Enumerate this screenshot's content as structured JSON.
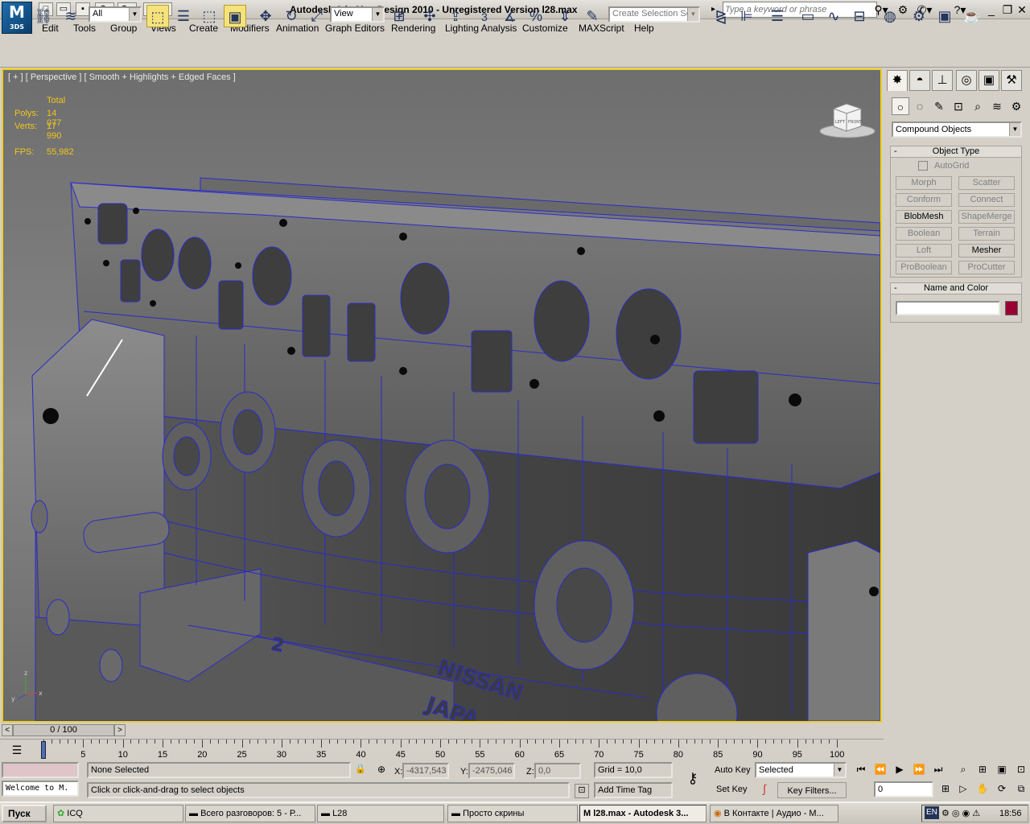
{
  "app": {
    "title": "Autodesk 3ds Max Design 2010  - Unregistered Version    l28.max",
    "logo_text": "3DS",
    "search_placeholder": "Type a keyword or phrase"
  },
  "menu": [
    "Edit",
    "Tools",
    "Group",
    "Views",
    "Create",
    "Modifiers",
    "Animation",
    "Graph Editors",
    "Rendering",
    "Lighting Analysis",
    "Customize",
    "MAXScript",
    "Help"
  ],
  "toolbar": {
    "filter_value": "All",
    "refcoord_value": "View",
    "selection_set_placeholder": "Create Selection Se",
    "snap_label": "3"
  },
  "viewport": {
    "label": "[ + ] [ Perspective ] [ Smooth + Highlights + Edged Faces ]",
    "stats": {
      "total_label": "Total",
      "polys_label": "Polys:",
      "polys_value": "14 077",
      "verts_label": "Verts:",
      "verts_value": "17 990",
      "fps_label": "FPS:",
      "fps_value": "55,982"
    },
    "viewcube": {
      "left": "LEFT",
      "front": "FRONT"
    },
    "axis": {
      "x": "x",
      "y": "y",
      "z": "z"
    },
    "engraving": {
      "number": "2",
      "brand_top": "NISSAN",
      "brand_bottom": "JAPA"
    }
  },
  "command_panel": {
    "category_value": "Compound Objects",
    "object_type": {
      "title": "Object Type",
      "autogrid": "AutoGrid",
      "buttons": [
        {
          "label": "Morph",
          "enabled": false
        },
        {
          "label": "Scatter",
          "enabled": false
        },
        {
          "label": "Conform",
          "enabled": false
        },
        {
          "label": "Connect",
          "enabled": false
        },
        {
          "label": "BlobMesh",
          "enabled": true
        },
        {
          "label": "ShapeMerge",
          "enabled": false
        },
        {
          "label": "Boolean",
          "enabled": false
        },
        {
          "label": "Terrain",
          "enabled": false
        },
        {
          "label": "Loft",
          "enabled": false
        },
        {
          "label": "Mesher",
          "enabled": true
        },
        {
          "label": "ProBoolean",
          "enabled": false
        },
        {
          "label": "ProCutter",
          "enabled": false
        }
      ]
    },
    "name_color": {
      "title": "Name and Color",
      "name_value": "",
      "swatch": "#990033"
    }
  },
  "timeline": {
    "slider_label": "0 / 100",
    "ticks": [
      "0",
      "5",
      "10",
      "15",
      "20",
      "25",
      "30",
      "35",
      "40",
      "45",
      "50",
      "55",
      "60",
      "65",
      "70",
      "75",
      "80",
      "85",
      "90",
      "95",
      "100"
    ],
    "current_frame": 0
  },
  "status": {
    "maxscript_listener": "Welcome to M.",
    "selection": "None Selected",
    "prompt": "Click or click-and-drag to select objects",
    "x_label": "X:",
    "x_value": "-4317,543",
    "y_label": "Y:",
    "y_value": "-2475,046",
    "z_label": "Z:",
    "z_value": "0,0",
    "grid": "Grid = 10,0",
    "add_time_tag": "Add Time Tag",
    "auto_key": "Auto Key",
    "set_key": "Set Key",
    "selected_value": "Selected",
    "key_filters": "Key Filters...",
    "frame_value": "0"
  },
  "taskbar": {
    "start": "Пуск",
    "tasks": [
      {
        "label": "ICQ",
        "active": false
      },
      {
        "label": "Всего разговоров: 5 - Р...",
        "active": false
      },
      {
        "label": "L28",
        "active": false
      },
      {
        "label": "Просто скрины",
        "active": false
      },
      {
        "label": "l28.max - Autodesk 3...",
        "active": true
      },
      {
        "label": "В Контакте | Аудио - М...",
        "active": false
      }
    ],
    "lang": "EN",
    "clock": "18:56"
  },
  "colors": {
    "viewport_border": "#f0d020",
    "stats_text": "#f3c51c",
    "wire": "#2a2acc"
  }
}
